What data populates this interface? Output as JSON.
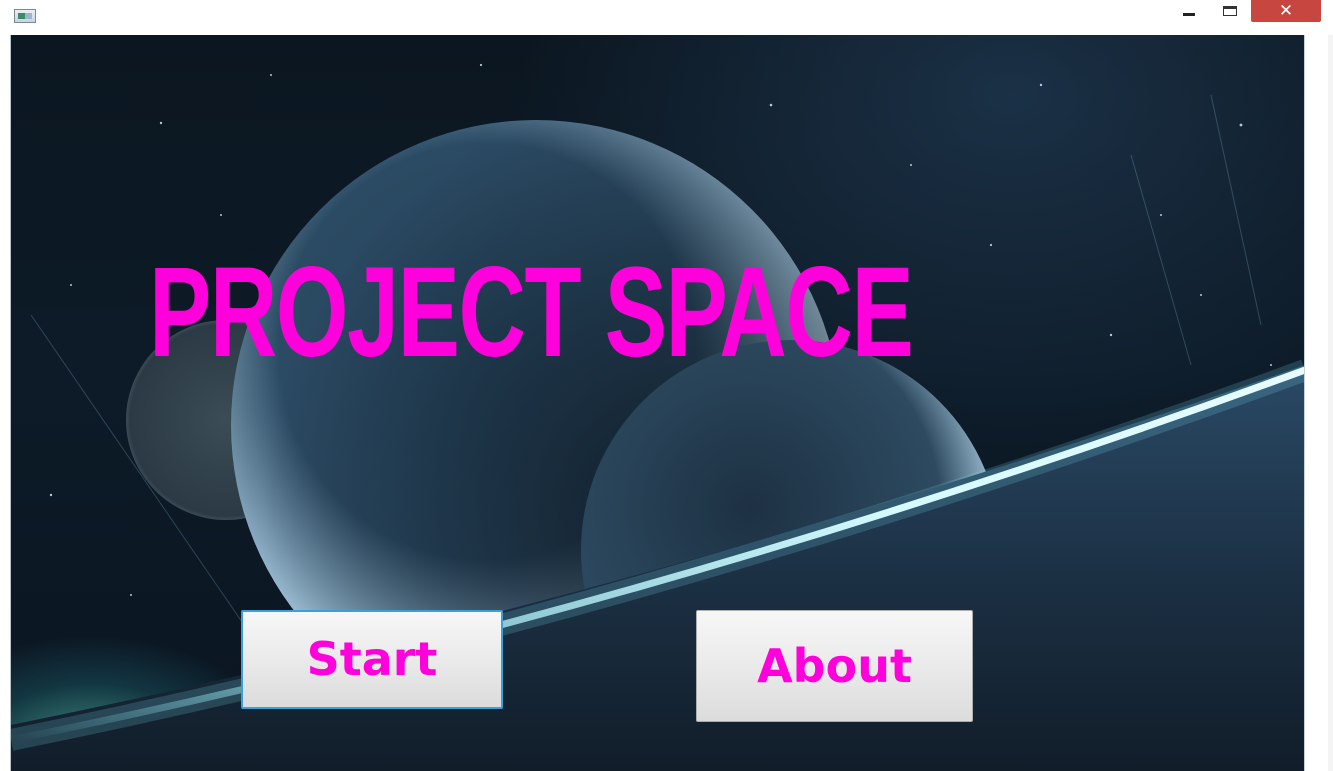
{
  "window": {
    "icon": "app-window-icon",
    "controls": {
      "minimize_icon": "minimize-icon",
      "maximize_icon": "maximize-icon",
      "close_icon": "close-icon",
      "close_glyph": "✕",
      "close_color": "#c7463f"
    }
  },
  "main": {
    "background": "space-planets-image",
    "title": "PROJECT SPACE",
    "title_color": "#ff00dd",
    "buttons": {
      "start_label": "Start",
      "about_label": "About"
    }
  }
}
